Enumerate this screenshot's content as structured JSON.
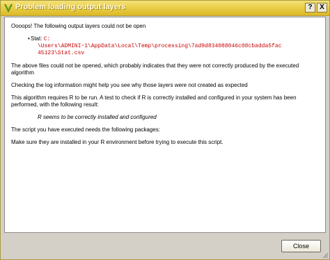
{
  "window": {
    "title": "Problem loading output layers",
    "help_label": "?",
    "close_label": "X"
  },
  "content": {
    "intro": "Oooops! The following output layers could not be open",
    "stat_label": "Stat:",
    "stat_path_lines": [
      "C:",
      "\\Users\\ADMINI~1\\AppData\\Local\\Temp\\processing\\7ad9d834088046c08cbadda5fac",
      "45123\\Stat.csv"
    ],
    "files_not_opened": "The above files could not be opened, which probably indicates that they were not correctly produced by the executed algorithm",
    "check_log": "Checking the log information might help you see why those layers were not created as expected",
    "requires_r": "This algorithm requires R to be run. A test to check if R is correctly installed and configured in your system has been performed, with the following result:",
    "r_result": "R seems to be correctly installed and configured",
    "packages_needed": "The script you have executed needs the following packages:",
    "make_sure": "Make sure they are installed in your R environment before trying to execute this script."
  },
  "footer": {
    "close_button_label": "Close"
  },
  "colors": {
    "path": "#c80000",
    "titlebar": "#e9cd45"
  }
}
